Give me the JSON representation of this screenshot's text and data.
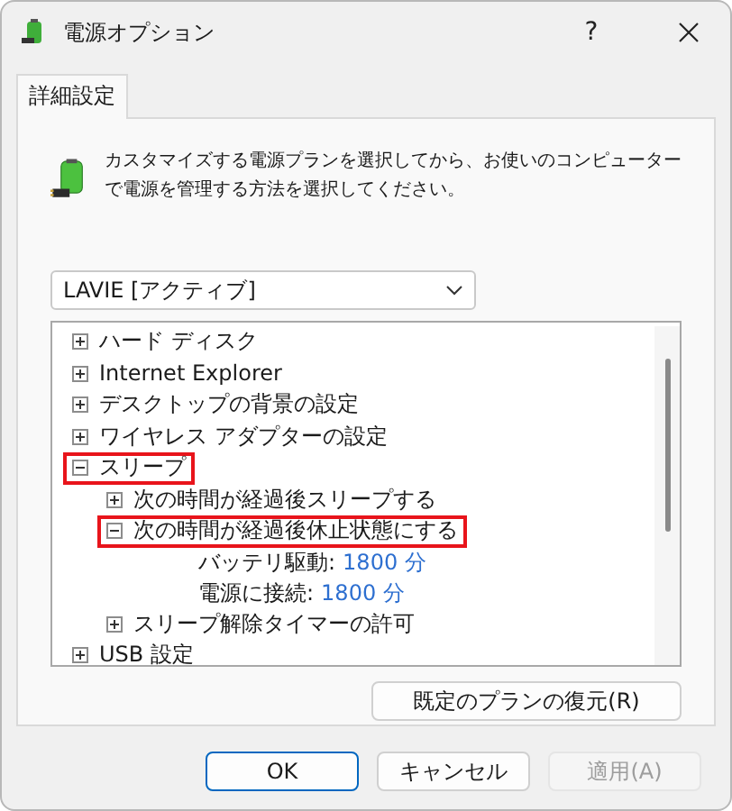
{
  "window": {
    "title": "電源オプション",
    "help": "?"
  },
  "tabs": [
    {
      "label": "詳細設定",
      "selected": true
    }
  ],
  "description": [
    "カスタマイズする電源プランを選択してから、お使いのコンピューター",
    "で電源を管理する方法を選択してください。"
  ],
  "plan_select": {
    "value": "LAVIE [アクティブ]"
  },
  "tree": [
    {
      "kind": "group",
      "label": "ハード ディスク",
      "expanded": false,
      "highlighted": false
    },
    {
      "kind": "group",
      "label": "Internet Explorer",
      "expanded": false,
      "highlighted": false
    },
    {
      "kind": "group",
      "label": "デスクトップの背景の設定",
      "expanded": false,
      "highlighted": false
    },
    {
      "kind": "group",
      "label": "ワイヤレス アダプターの設定",
      "expanded": false,
      "highlighted": false
    },
    {
      "kind": "group",
      "label": "スリープ",
      "expanded": true,
      "highlighted": true,
      "children": [
        {
          "kind": "group",
          "label": "次の時間が経過後スリープする",
          "expanded": false,
          "highlighted": false
        },
        {
          "kind": "group",
          "label": "次の時間が経過後休止状態にする",
          "expanded": true,
          "highlighted": true,
          "children": [
            {
              "kind": "setting",
              "label": "バッテリ駆動:",
              "value": "1800 分"
            },
            {
              "kind": "setting",
              "label": "電源に接続:",
              "value": "1800 分"
            }
          ]
        },
        {
          "kind": "group",
          "label": "スリープ解除タイマーの許可",
          "expanded": false,
          "highlighted": false
        }
      ]
    },
    {
      "kind": "group",
      "label": "USB 設定",
      "expanded": false,
      "highlighted": false
    }
  ],
  "restore_button": {
    "label": "既定のプランの復元(R)",
    "disabled": false
  },
  "buttons": [
    {
      "label": "OK",
      "default": true,
      "disabled": false
    },
    {
      "label": "キャンセル",
      "default": false,
      "disabled": false
    },
    {
      "label": "適用(A)",
      "default": false,
      "disabled": true
    }
  ]
}
